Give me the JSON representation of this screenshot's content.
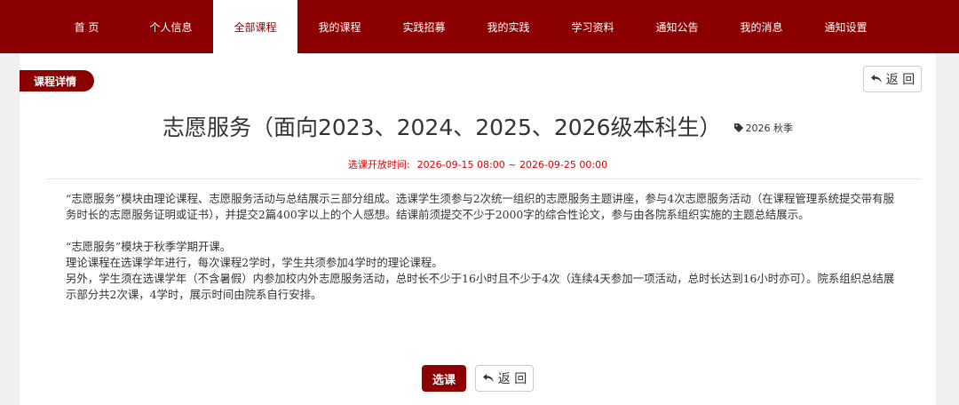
{
  "nav": {
    "items": [
      {
        "label": "首 页"
      },
      {
        "label": "个人信息"
      },
      {
        "label": "全部课程",
        "active": true
      },
      {
        "label": "我的课程"
      },
      {
        "label": "实践招募"
      },
      {
        "label": "我的实践"
      },
      {
        "label": "学习资料"
      },
      {
        "label": "通知公告"
      },
      {
        "label": "我的消息"
      },
      {
        "label": "通知设置"
      }
    ]
  },
  "page": {
    "section_label": "课程详情",
    "back_label": "返 回",
    "course_title": "志愿服务（面向2023、2024、2025、2026级本科生）",
    "term_label": "2026 秋季",
    "open_time_label": "选课开放时间:",
    "open_time_value": "2026-09-15 08:00 ~ 2026-09-25 00:00",
    "description": [
      "“志愿服务”模块由理论课程、志愿服务活动与总结展示三部分组成。选课学生须参与2次统一组织的志愿服务主题讲座，参与4次志愿服务活动（在课程管理系统提交带有服务时长的志愿服务证明或证书），并提交2篇400字以上的个人感想。结课前须提交不少于2000字的综合性论文，参与由各院系组织实施的主题总结展示。",
      "",
      "“志愿服务”模块于秋季学期开课。",
      "理论课程在选课学年进行，每次课程2学时，学生共须参加4学时的理论课程。",
      "另外，学生须在选课学年（不含暑假）内参加校内外志愿服务活动，总时长不少于16小时且不少于4次（连续4天参加一项活动，总时长达到16小时亦可）。院系组织总结展示部分共2次课，4学时，展示时间由院系自行安排。"
    ],
    "select_button": "选课",
    "back_button": "返 回"
  },
  "colors": {
    "primary": "#8b0000",
    "time_text": "#e00000"
  },
  "icons": {
    "back": "undo-arrow-icon",
    "tag": "tag-icon"
  }
}
